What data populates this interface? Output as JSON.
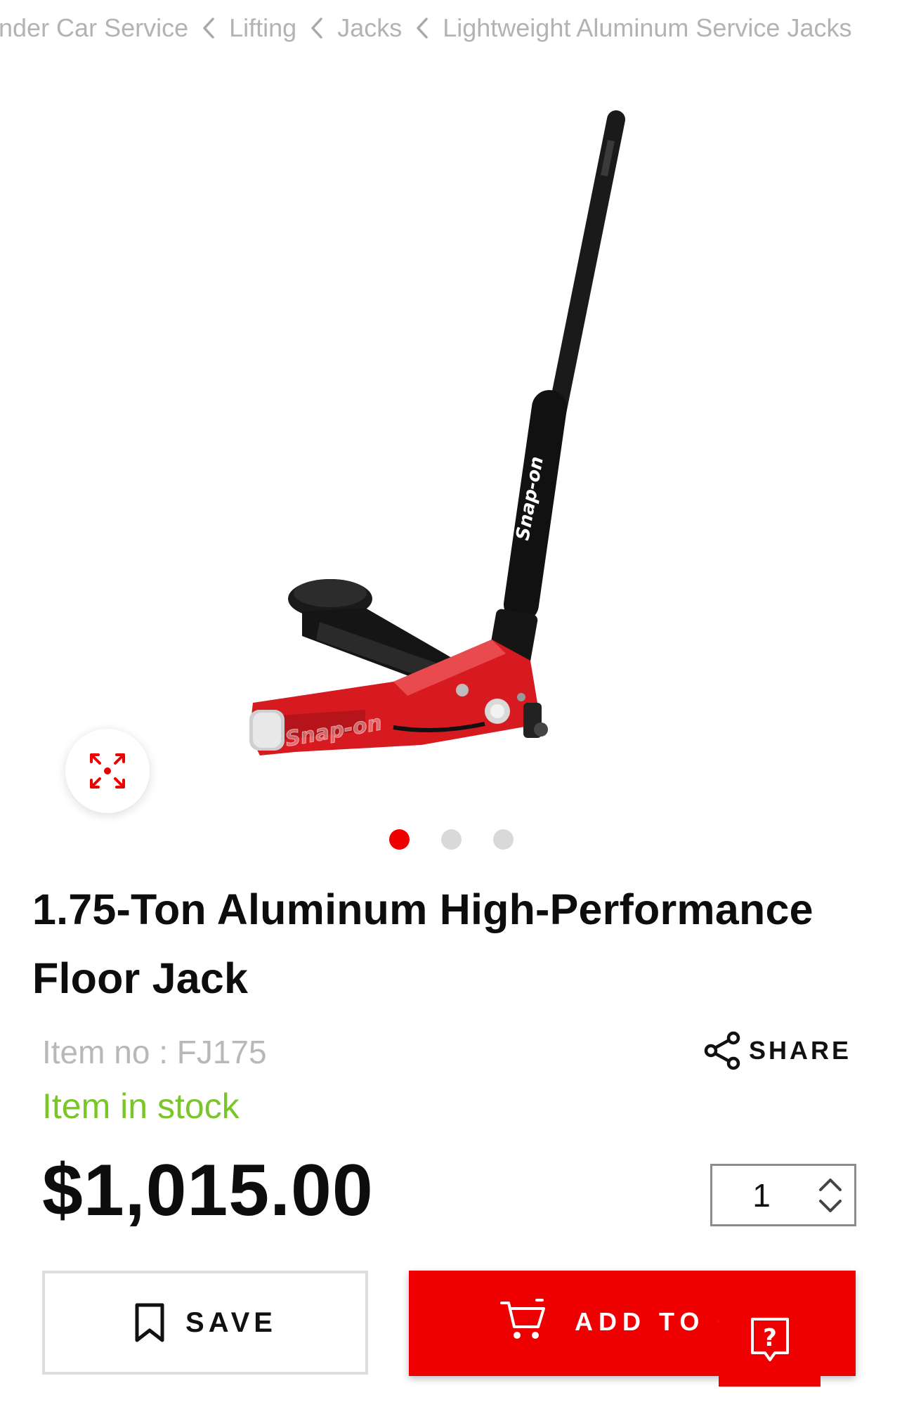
{
  "breadcrumb": {
    "items": [
      "nder Car Service",
      "Lifting",
      "Jacks",
      "Lightweight Aluminum Service Jacks"
    ]
  },
  "gallery": {
    "expand_icon": "expand-arrows-icon",
    "slide_count": 3,
    "active_slide": 1,
    "product_image": "red-aluminum-floor-jack-with-black-handle",
    "brand_logo_text": "Snap-on"
  },
  "product": {
    "title": "1.75-Ton Aluminum High-Performance Floor Jack",
    "item_no": "Item no : FJ175",
    "stock_status": "Item in stock",
    "price": "$1,015.00"
  },
  "share": {
    "label": "SHARE",
    "icon": "share-icon"
  },
  "quantity": {
    "value": "1",
    "icon": "stepper-arrows-icon"
  },
  "actions": {
    "save_label": "SAVE",
    "save_icon": "bookmark-icon",
    "add_to_cart_label": "ADD TO CART",
    "cart_icon": "cart-icon",
    "help_icon": "help-question-icon"
  },
  "colors": {
    "accent": "#ee0000",
    "in_stock": "#7ac629",
    "muted_text": "#b3b3b3"
  }
}
